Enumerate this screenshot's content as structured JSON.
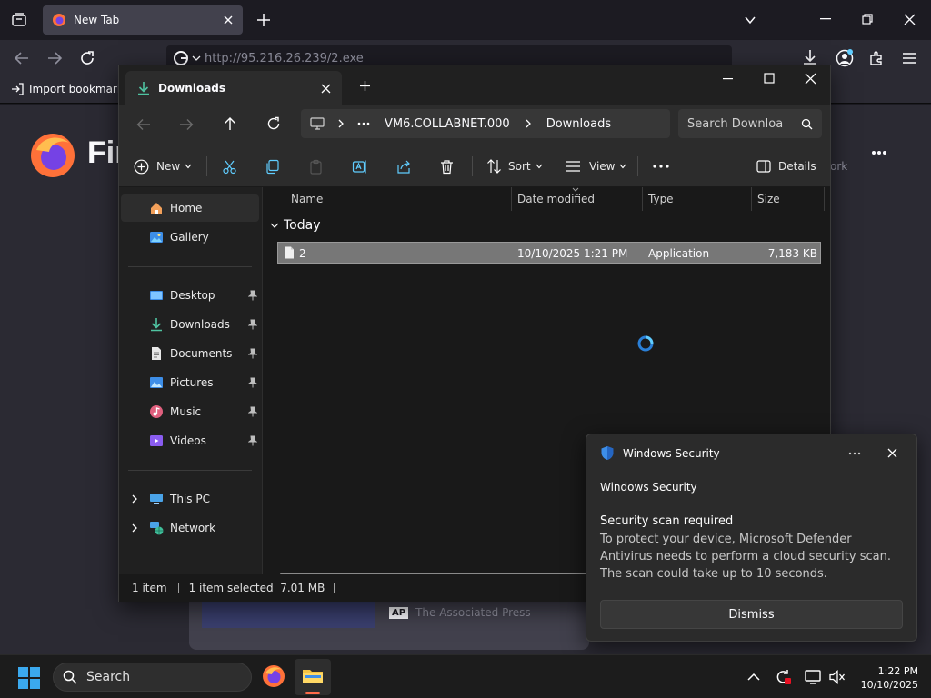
{
  "browser": {
    "tab_title": "New Tab",
    "url": "http://95.216.26.239/2.exe",
    "bookmark_item": "Import bookmarks",
    "firefox_partial": "Fir",
    "partial_network": "ork",
    "news_source": "The Associated Press",
    "news_source_logo": "AP"
  },
  "explorer": {
    "tab_title": "Downloads",
    "breadcrumb": [
      "VM6.COLLABNET.000",
      "Downloads"
    ],
    "search_placeholder": "Search Downloa",
    "toolbar": {
      "new": "New",
      "sort": "Sort",
      "view": "View",
      "details": "Details"
    },
    "nav": {
      "home": "Home",
      "gallery": "Gallery",
      "desktop": "Desktop",
      "downloads": "Downloads",
      "documents": "Documents",
      "pictures": "Pictures",
      "music": "Music",
      "videos": "Videos",
      "this_pc": "This PC",
      "network": "Network"
    },
    "columns": {
      "name": "Name",
      "date": "Date modified",
      "type": "Type",
      "size": "Size"
    },
    "group": "Today",
    "files": [
      {
        "name": "2",
        "date": "10/10/2025 1:21 PM",
        "type": "Application",
        "size": "7,183 KB"
      }
    ],
    "status": {
      "count": "1 item",
      "selected": "1 item selected  7.01 MB"
    }
  },
  "toast": {
    "app": "Windows Security",
    "header": "Windows Security",
    "title": "Security scan required",
    "body": "To protect your device, Microsoft Defender Antivirus needs to perform a cloud security scan. The scan could take up to 10 seconds.",
    "button": "Dismiss"
  },
  "taskbar": {
    "search": "Search",
    "time": "1:22 PM",
    "date": "10/10/2025"
  },
  "colors": {
    "accent": "#60cdff",
    "folder": "#f5c342",
    "defender": "#3d8ee8"
  }
}
